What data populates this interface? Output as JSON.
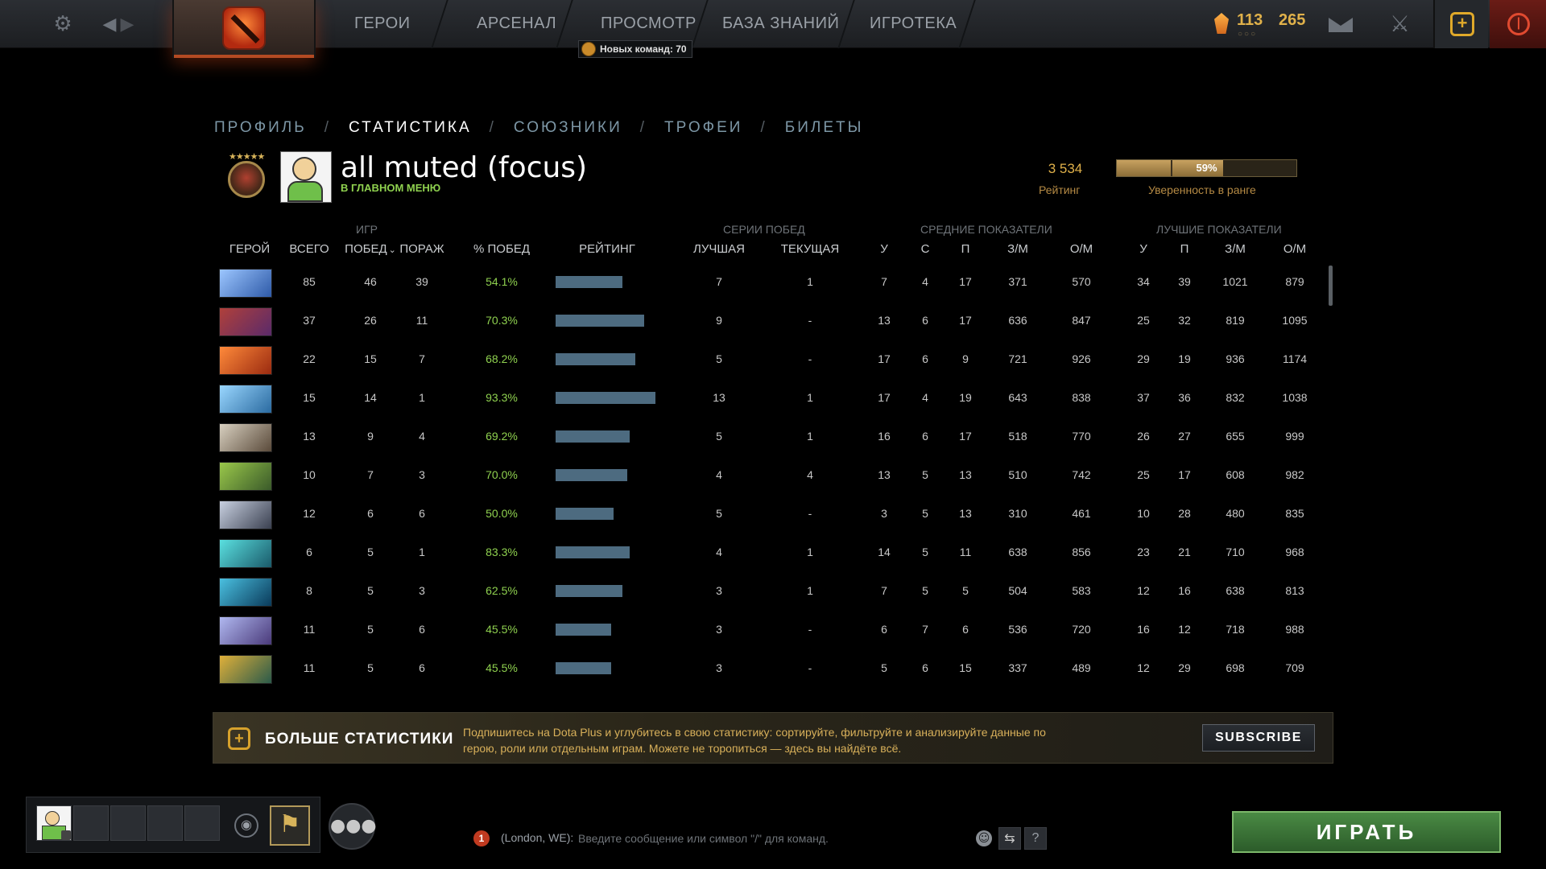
{
  "nav": {
    "items": [
      "ГЕРОИ",
      "АРСЕНАЛ",
      "ПРОСМОТР",
      "БАЗА ЗНАНИЙ",
      "ИГРОТЕКА"
    ],
    "new_teams_badge": "Новых команд: 70",
    "shards_a": "113",
    "shards_b": "265",
    "shards_dots": "○○○"
  },
  "profile_tabs": [
    "ПРОФИЛЬ",
    "СТАТИСТИКА",
    "СОЮЗНИКИ",
    "ТРОФЕИ",
    "БИЛЕТЫ"
  ],
  "active_tab": "СТАТИСТИКА",
  "player": {
    "name": "all muted (focus)",
    "status": "В ГЛАВНОМ МЕНЮ",
    "rating": "3 534",
    "rating_label": "Рейтинг",
    "confidence": "59%",
    "confidence_fraction": 0.59,
    "confidence_label": "Уверенность в ранге"
  },
  "table": {
    "groups": {
      "games": "ИГР",
      "streaks": "СЕРИИ ПОБЕД",
      "averages": "СРЕДНИЕ ПОКАЗАТЕЛИ",
      "bests": "ЛУЧШИЕ ПОКАЗАТЕЛИ"
    },
    "headers": {
      "hero": "ГЕРОЙ",
      "total": "ВСЕГО",
      "wins": "ПОБЕД",
      "sort_indicator": "⌄",
      "losses": "ПОРАЖ",
      "winrate": "% ПОБЕД",
      "rating": "РЕЙТИНГ",
      "best_streak": "ЛУЧШАЯ",
      "current_streak": "ТЕКУЩАЯ",
      "avg_k": "У",
      "avg_d": "С",
      "avg_a": "П",
      "avg_gpm": "З/М",
      "avg_xpm": "О/М",
      "best_k": "У",
      "best_a": "П",
      "best_gpm": "З/М",
      "best_xpm": "О/М"
    },
    "rows": [
      {
        "hero": "hero-1",
        "total": "85",
        "wins": "46",
        "losses": "39",
        "winrate": "54.1%",
        "rating": 0.67,
        "best": "7",
        "current": "1",
        "k": "7",
        "d": "4",
        "a": "17",
        "gpm": "371",
        "xpm": "570",
        "bk": "34",
        "ba": "39",
        "bgpm": "1021",
        "bxpm": "879"
      },
      {
        "hero": "hero-2",
        "total": "37",
        "wins": "26",
        "losses": "11",
        "winrate": "70.3%",
        "rating": 0.89,
        "best": "9",
        "current": "-",
        "k": "13",
        "d": "6",
        "a": "17",
        "gpm": "636",
        "xpm": "847",
        "bk": "25",
        "ba": "32",
        "bgpm": "819",
        "bxpm": "1095"
      },
      {
        "hero": "hero-3",
        "total": "22",
        "wins": "15",
        "losses": "7",
        "winrate": "68.2%",
        "rating": 0.8,
        "best": "5",
        "current": "-",
        "k": "17",
        "d": "6",
        "a": "9",
        "gpm": "721",
        "xpm": "926",
        "bk": "29",
        "ba": "19",
        "bgpm": "936",
        "bxpm": "1174"
      },
      {
        "hero": "hero-4",
        "total": "15",
        "wins": "14",
        "losses": "1",
        "winrate": "93.3%",
        "rating": 1.0,
        "best": "13",
        "current": "1",
        "k": "17",
        "d": "4",
        "a": "19",
        "gpm": "643",
        "xpm": "838",
        "bk": "37",
        "ba": "36",
        "bgpm": "832",
        "bxpm": "1038"
      },
      {
        "hero": "hero-5",
        "total": "13",
        "wins": "9",
        "losses": "4",
        "winrate": "69.2%",
        "rating": 0.74,
        "best": "5",
        "current": "1",
        "k": "16",
        "d": "6",
        "a": "17",
        "gpm": "518",
        "xpm": "770",
        "bk": "26",
        "ba": "27",
        "bgpm": "655",
        "bxpm": "999"
      },
      {
        "hero": "hero-6",
        "total": "10",
        "wins": "7",
        "losses": "3",
        "winrate": "70.0%",
        "rating": 0.72,
        "best": "4",
        "current": "4",
        "k": "13",
        "d": "5",
        "a": "13",
        "gpm": "510",
        "xpm": "742",
        "bk": "25",
        "ba": "17",
        "bgpm": "608",
        "bxpm": "982"
      },
      {
        "hero": "hero-7",
        "total": "12",
        "wins": "6",
        "losses": "6",
        "winrate": "50.0%",
        "rating": 0.58,
        "best": "5",
        "current": "-",
        "k": "3",
        "d": "5",
        "a": "13",
        "gpm": "310",
        "xpm": "461",
        "bk": "10",
        "ba": "28",
        "bgpm": "480",
        "bxpm": "835"
      },
      {
        "hero": "hero-8",
        "total": "6",
        "wins": "5",
        "losses": "1",
        "winrate": "83.3%",
        "rating": 0.74,
        "best": "4",
        "current": "1",
        "k": "14",
        "d": "5",
        "a": "11",
        "gpm": "638",
        "xpm": "856",
        "bk": "23",
        "ba": "21",
        "bgpm": "710",
        "bxpm": "968"
      },
      {
        "hero": "hero-9",
        "total": "8",
        "wins": "5",
        "losses": "3",
        "winrate": "62.5%",
        "rating": 0.67,
        "best": "3",
        "current": "1",
        "k": "7",
        "d": "5",
        "a": "5",
        "gpm": "504",
        "xpm": "583",
        "bk": "12",
        "ba": "16",
        "bgpm": "638",
        "bxpm": "813"
      },
      {
        "hero": "hero-10",
        "total": "11",
        "wins": "5",
        "losses": "6",
        "winrate": "45.5%",
        "rating": 0.56,
        "best": "3",
        "current": "-",
        "k": "6",
        "d": "7",
        "a": "6",
        "gpm": "536",
        "xpm": "720",
        "bk": "16",
        "ba": "12",
        "bgpm": "718",
        "bxpm": "988"
      },
      {
        "hero": "hero-11",
        "total": "11",
        "wins": "5",
        "losses": "6",
        "winrate": "45.5%",
        "rating": 0.56,
        "best": "3",
        "current": "-",
        "k": "5",
        "d": "6",
        "a": "15",
        "gpm": "337",
        "xpm": "489",
        "bk": "12",
        "ba": "29",
        "bgpm": "698",
        "bxpm": "709"
      }
    ]
  },
  "banner": {
    "title": "БОЛЬШЕ СТАТИСТИКИ",
    "description": "Подпишитесь на Dota Plus и углубитесь в свою статистику: сортируйте, фильтруйте и анализируйте данные по герою, роли или отдельным играм. Можете не торопиться — здесь вы найдёте всё.",
    "subscribe": "SUBSCRIBE"
  },
  "bottom": {
    "chat_count": "1",
    "chat_channel": "(London, WE):",
    "chat_placeholder": "Введите сообщение или символ \"/\" для команд.",
    "help": "?",
    "play": "ИГРАТЬ"
  },
  "colors": {
    "accent_gold": "#e0b14a",
    "win_green": "#8fd14f",
    "rating_bar": "#4d6b80",
    "play_green": "#3c7a38"
  },
  "icons": [
    "settings-icon",
    "back-arrow-icon",
    "forward-arrow-icon",
    "dota-logo",
    "shard-icon",
    "mail-icon",
    "armory-icon",
    "dota-plus-icon",
    "power-icon",
    "voice-icon",
    "battle-cup-icon",
    "friends-icon",
    "emoji-icon",
    "chat-mode-icon",
    "help-icon"
  ]
}
